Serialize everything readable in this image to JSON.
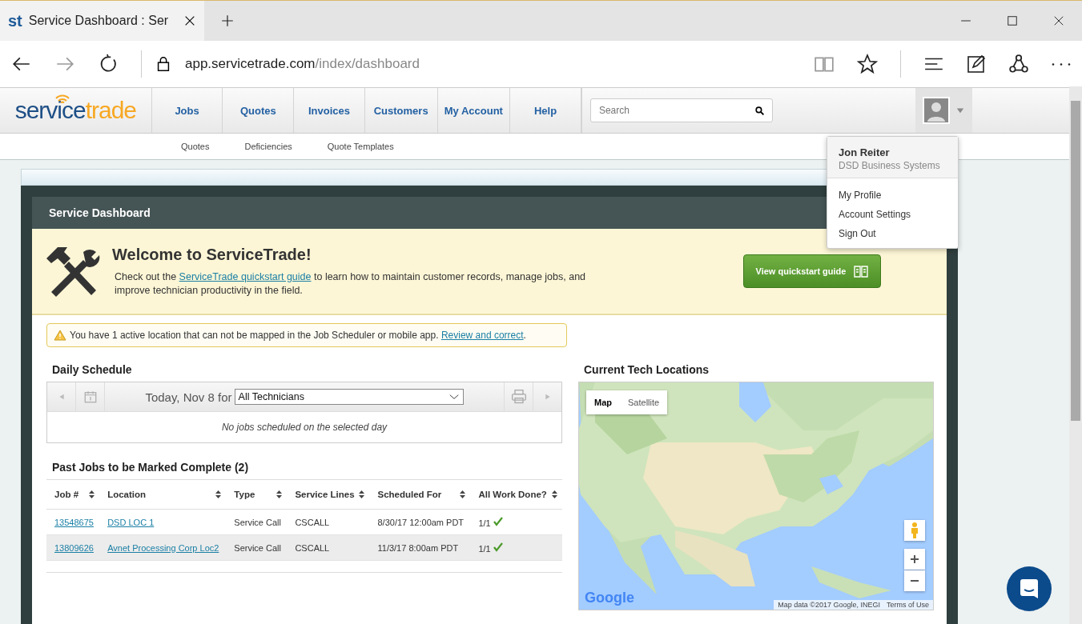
{
  "browser": {
    "favicon": "st",
    "tab_title": "Service Dashboard : Ser",
    "url_host": "app.servicetrade.com",
    "url_path": "/index/dashboard"
  },
  "logo": {
    "part_1": "service",
    "part_2": "trade"
  },
  "nav": [
    "Jobs",
    "Quotes",
    "Invoices",
    "Customers",
    "My Account",
    "Help"
  ],
  "search": {
    "placeholder": "Search"
  },
  "subnav": [
    "Quotes",
    "Deficiencies",
    "Quote Templates"
  ],
  "user_menu": {
    "name": "Jon Reiter",
    "company": "DSD Business Systems",
    "items": [
      "My Profile",
      "Account Settings",
      "Sign Out"
    ]
  },
  "panel_title": "Service Dashboard",
  "welcome": {
    "title": "Welcome to ServiceTrade!",
    "text_before": "Check out the ",
    "link": "ServiceTrade quickstart guide",
    "text_after": " to learn how to maintain customer records, manage jobs, and improve technician productivity in the field.",
    "button": "View quickstart guide"
  },
  "alert": {
    "text": "You have 1 active location that can not be mapped in the Job Scheduler or mobile app. ",
    "link": "Review and correct",
    "end": "."
  },
  "schedule": {
    "title": "Daily Schedule",
    "date": "Today, Nov 8 for",
    "technician": "All Technicians",
    "empty": "No jobs scheduled on the selected day"
  },
  "past_jobs": {
    "title": "Past Jobs to be Marked Complete (2)",
    "columns": [
      "Job #",
      "Location",
      "Type",
      "Service Lines",
      "Scheduled For",
      "All Work Done?"
    ],
    "rows": [
      {
        "job": "13548675",
        "location": "DSD LOC 1",
        "type": "Service Call",
        "service_lines": "CSCALL",
        "scheduled": "8/30/17 12:00am PDT",
        "done": "1/1",
        "complete": true
      },
      {
        "job": "13809626",
        "location": "Avnet Processing Corp Loc2",
        "type": "Service Call",
        "service_lines": "CSCALL",
        "scheduled": "11/3/17 8:00am PDT",
        "done": "1/1",
        "complete": true
      }
    ]
  },
  "map": {
    "title": "Current Tech Locations",
    "types": [
      {
        "label": "Map",
        "selected": true
      },
      {
        "label": "Satellite",
        "selected": false
      }
    ],
    "logo": "Google",
    "attribution": "Map data ©2017 Google, INEGI",
    "terms": "Terms of Use"
  }
}
